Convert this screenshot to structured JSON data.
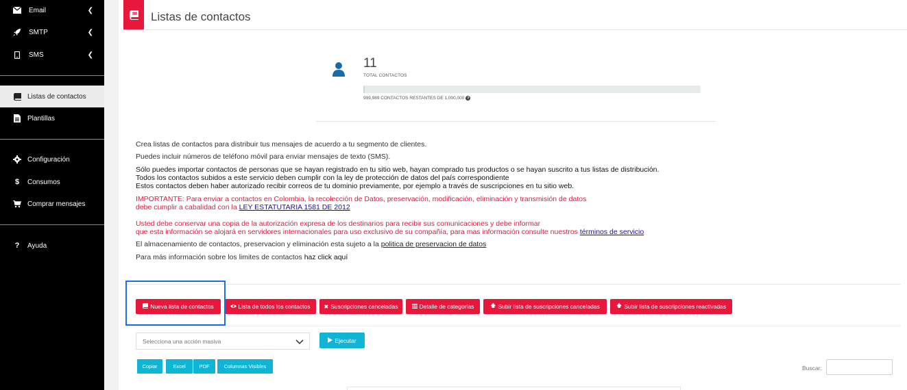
{
  "sidebar": {
    "items": [
      {
        "label": "Email",
        "icon": "envelope-icon"
      },
      {
        "label": "SMTP",
        "icon": "rocket-icon"
      },
      {
        "label": "SMS",
        "icon": "mobile-icon"
      },
      {
        "label": "Listas de contactos",
        "icon": "book-icon"
      },
      {
        "label": "Plantillas",
        "icon": "document-icon"
      },
      {
        "label": "Configuración",
        "icon": "gear-icon"
      },
      {
        "label": "Consumos",
        "icon": "dollar-icon"
      },
      {
        "label": "Comprar mensajes",
        "icon": "cart-icon"
      },
      {
        "label": "Ayuda",
        "icon": "question-icon"
      }
    ]
  },
  "header": {
    "title": "Listas de contactos",
    "icon": "book-icon"
  },
  "stats": {
    "count": "11",
    "count_label": "TOTAL CONTACTOS",
    "remaining_label": "999,989 CONTACTOS RESTANTES DE 1,000,000",
    "progress_fraction": 1.1e-05
  },
  "info": {
    "line1": "Crea listas de contactos para distribuir tus mensajes de acuerdo a tu segmento de clientes.",
    "line2": "Puedes incluir números de teléfono móvil para enviar mensajes de texto (SMS).",
    "line3": "Sólo puedes importar contactos de personas que se hayan registrado en tu sitio web, hayan comprado tus productos o se hayan suscrito a tus listas de distribución.",
    "line4": "Todos los contactos subidos a este servicio deben cumplir con la ley de protección de datos del país correspondiente",
    "line5": "Estos contactos deben haber autorizado recibir correos de tu dominio previamente, por ejemplo a través de suscripciones en tu sitio web.",
    "important1": "IMPORTANTE: Para enviar a contactos en Colombia, la recolección de Datos, preservación, modificación, eliminación y transmisión de datos",
    "important2": "debe cumplir a cabalidad con la ",
    "law_link": "LEY ESTATUTARIA 1581 DE 2012",
    "conserve1": "Usted debe conservar una copia de la autorización expresa de los destinarios para recibir sus comunicaciones y debe informar",
    "conserve2": "que esta información se alojará en servidores internacionales para uso exclusivo de su compañía, para mas información consulte nuestros ",
    "terms_link": "términos de servicio",
    "storage": "El almacenamiento de contactos, preservacion y eliminación esta sujeto a la ",
    "policy_link": "politica de preservacion de datos",
    "more": "Para más información sobre los limites de contactos ",
    "more_link": "haz click aquí"
  },
  "actions": {
    "new_list": "Nueva lista de contactos",
    "all_contacts": "Lista de todos los contactos",
    "cancelled": "Suscripciones canceladas",
    "categories": "Detalle de categorias",
    "upload_cancelled": "Subir lista de suscripciones canceladas",
    "upload_reactivated": "Subir lista de suscripciones reactivadas"
  },
  "bulk": {
    "placeholder": "Selecciona una acción masiva",
    "execute": "Ejecutar"
  },
  "table_tools": {
    "copy": "Copiar",
    "excel": "Excel",
    "pdf": "PDF",
    "columns": "Columnas Visibles",
    "search_label": "Buscar:"
  },
  "colors": {
    "accent": "#e8173c",
    "secondary": "#10b5d5",
    "sidebar_bg": "#000000",
    "highlight": "#1a6de8"
  }
}
